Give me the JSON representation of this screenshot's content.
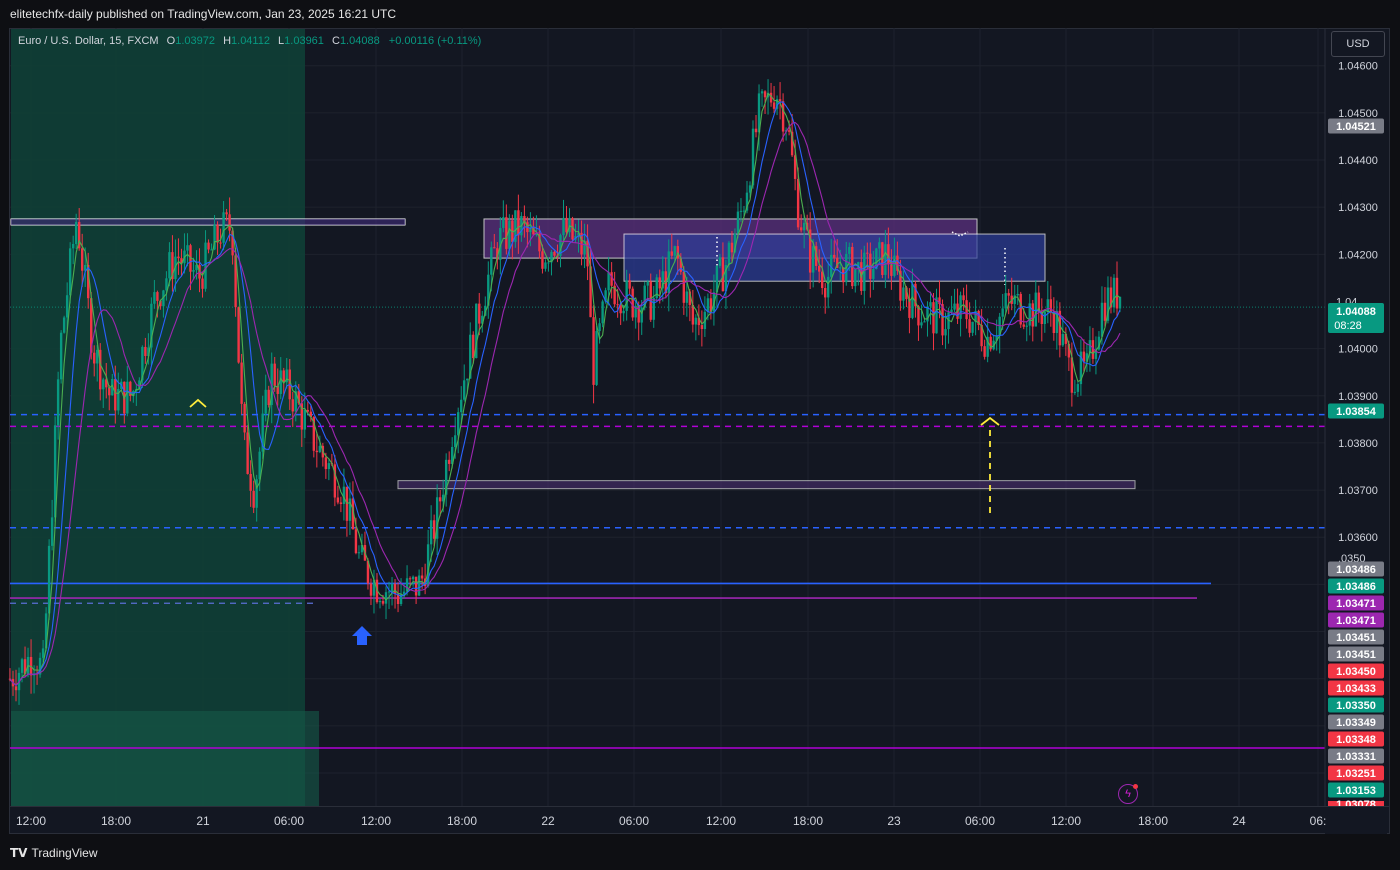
{
  "header": {
    "published_line": "elitetechfx-daily published on TradingView.com, Jan 23, 2025 16:21 UTC"
  },
  "legend": {
    "symbol_line": "Euro / U.S. Dollar, 15, FXCM",
    "open_key": "O",
    "open_value": "1.03972",
    "high_key": "H",
    "high_value": "1.04112",
    "low_key": "L",
    "low_value": "1.03961",
    "close_key": "C",
    "close_value": "1.04088",
    "change": "+0.00116 (+0.11%)"
  },
  "toolbar": {
    "currency_label": "USD"
  },
  "footer": {
    "brand": "TradingView"
  },
  "icons": {
    "tv_logo": "tradingview-logo-icon",
    "flash": "lightning-icon",
    "arrow_up": "arrow-up-icon"
  },
  "colors": {
    "up": "#089981",
    "down": "#f23645",
    "ma_green": "#4caf50",
    "ma_blue": "#2962ff",
    "ma_purple": "#9c27b0",
    "blue_dash": "#2962ff",
    "purple_dash": "#b000d6",
    "yellow": "#ffeb3b"
  },
  "chart_data": {
    "type": "candlestick",
    "symbol": "Euro / U.S. Dollar",
    "timeframe": "15",
    "x_axis_ticks": [
      "12:00",
      "18:00",
      "21",
      "06:00",
      "12:00",
      "18:00",
      "22",
      "06:00",
      "12:00",
      "18:00",
      "23",
      "06:00",
      "12:00",
      "18:00",
      "24",
      "06:"
    ],
    "y_axis_ticks": [
      "1.04600",
      "1.04500",
      "1.04400",
      "1.04300",
      "1.04200",
      "1.04000",
      "1.03900",
      "1.03800",
      "1.03700",
      "1.03600"
    ],
    "ylim": [
      1.0303,
      1.0468
    ],
    "current_price": {
      "value": "1.04088",
      "countdown": "08:28"
    },
    "price_labels": [
      {
        "value": "1.04521",
        "color": "#787b86"
      },
      {
        "value": "1.03854",
        "color": "#089981"
      },
      {
        "value": "1.03486",
        "color": "#787b86"
      },
      {
        "value": "1.03486",
        "color": "#089981"
      },
      {
        "value": "1.03471",
        "color": "#9c27b0"
      },
      {
        "value": "1.03471",
        "color": "#9c27b0"
      },
      {
        "value": "1.03451",
        "color": "#787b86"
      },
      {
        "value": "1.03451",
        "color": "#787b86"
      },
      {
        "value": "1.03450",
        "color": "#f23645"
      },
      {
        "value": "1.03433",
        "color": "#f23645"
      },
      {
        "value": "1.03350",
        "color": "#089981"
      },
      {
        "value": "1.03349",
        "color": "#787b86"
      },
      {
        "value": "1.03348",
        "color": "#f23645"
      },
      {
        "value": "1.03331",
        "color": "#787b86"
      },
      {
        "value": "1.03251",
        "color": "#f23645"
      },
      {
        "value": "1.03153",
        "color": "#089981"
      }
    ],
    "partial_axis_labels": [
      "1.04",
      ".0350",
      "1.03078"
    ],
    "levels": {
      "blue_dashed": [
        1.0386,
        1.0362,
        1.0346
      ],
      "purple_dashed": 1.03835,
      "blue_solid": 1.03502,
      "purple_solid": 1.03471,
      "purple_bottom": 1.03153,
      "current_dotted": 1.04088
    },
    "zones": [
      {
        "name": "resistance-top-zone",
        "x_start": 0,
        "x_end": 0.28,
        "y_top": 1.04275,
        "y_bottom": 1.04262,
        "style": "outline"
      },
      {
        "name": "supply-zone-purple",
        "y_top": 1.04275,
        "y_bottom": 1.04192,
        "style": "purple"
      },
      {
        "name": "supply-zone-blue",
        "y_top": 1.04243,
        "y_bottom": 1.04143,
        "style": "blue"
      },
      {
        "name": "demand-zone-bottom",
        "y_top": 1.0372,
        "y_bottom": 1.03702,
        "style": "outline"
      }
    ],
    "price_path": [
      [
        0,
        1.033
      ],
      [
        0.02,
        1.0335
      ],
      [
        0.03,
        1.0332
      ],
      [
        0.045,
        1.04
      ],
      [
        0.06,
        1.0428
      ],
      [
        0.075,
        1.04
      ],
      [
        0.09,
        1.039
      ],
      [
        0.11,
        1.039
      ],
      [
        0.13,
        1.041
      ],
      [
        0.15,
        1.042
      ],
      [
        0.17,
        1.0415
      ],
      [
        0.19,
        1.0425
      ],
      [
        0.2,
        1.0426
      ],
      [
        0.21,
        1.038
      ],
      [
        0.22,
        1.037
      ],
      [
        0.235,
        1.0395
      ],
      [
        0.255,
        1.039
      ],
      [
        0.275,
        1.038
      ],
      [
        0.3,
        1.037
      ],
      [
        0.315,
        1.0355
      ],
      [
        0.33,
        1.035
      ],
      [
        0.35,
        1.0348
      ],
      [
        0.37,
        1.035
      ],
      [
        0.385,
        1.0365
      ],
      [
        0.4,
        1.0385
      ],
      [
        0.415,
        1.04
      ],
      [
        0.425,
        1.041
      ],
      [
        0.44,
        1.0423
      ],
      [
        0.46,
        1.0426
      ],
      [
        0.48,
        1.042
      ],
      [
        0.5,
        1.0425
      ],
      [
        0.52,
        1.042
      ],
      [
        0.525,
        1.0395
      ],
      [
        0.54,
        1.0414
      ],
      [
        0.56,
        1.041
      ],
      [
        0.58,
        1.041
      ],
      [
        0.6,
        1.042
      ],
      [
        0.615,
        1.0405
      ],
      [
        0.63,
        1.041
      ],
      [
        0.645,
        1.0418
      ],
      [
        0.66,
        1.043
      ],
      [
        0.675,
        1.045
      ],
      [
        0.69,
        1.0455
      ],
      [
        0.7,
        1.0448
      ],
      [
        0.71,
        1.043
      ],
      [
        0.72,
        1.042
      ],
      [
        0.735,
        1.0415
      ],
      [
        0.75,
        1.0418
      ],
      [
        0.77,
        1.0416
      ],
      [
        0.79,
        1.042
      ],
      [
        0.8,
        1.0414
      ],
      [
        0.82,
        1.0408
      ],
      [
        0.84,
        1.0406
      ],
      [
        0.86,
        1.0408
      ],
      [
        0.88,
        1.0402
      ],
      [
        0.9,
        1.041
      ],
      [
        0.92,
        1.0408
      ],
      [
        0.94,
        1.0408
      ],
      [
        0.955,
        1.0395
      ],
      [
        0.97,
        1.0395
      ],
      [
        0.985,
        1.041
      ],
      [
        1.0,
        1.0412
      ],
      [
        1.01,
        1.04
      ],
      [
        1.03,
        1.0405
      ],
      [
        1.05,
        1.0408
      ],
      [
        1.06,
        1.0395
      ],
      [
        1.07,
        1.0408
      ]
    ]
  }
}
